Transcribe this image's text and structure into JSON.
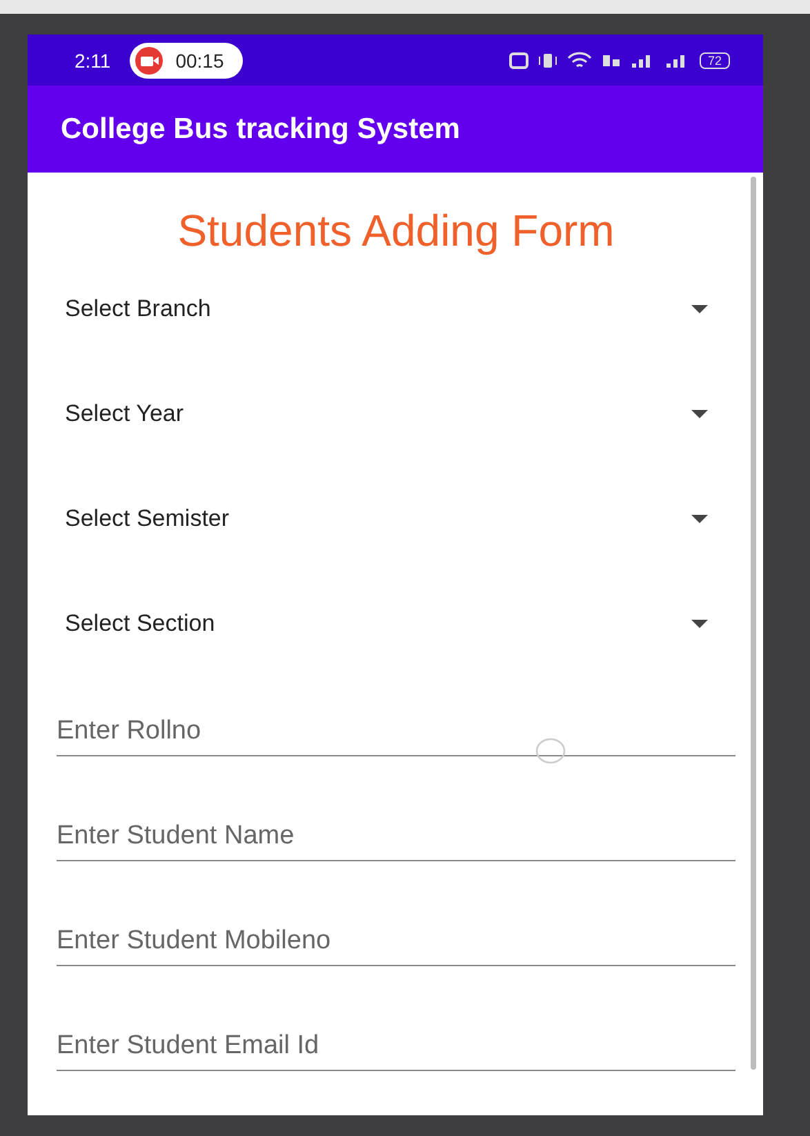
{
  "status_bar": {
    "time": "2:11",
    "recording_timer": "00:15",
    "battery_level": "72"
  },
  "app_bar": {
    "title": "College Bus tracking System"
  },
  "form": {
    "title": "Students Adding Form",
    "dropdowns": [
      {
        "label": "Select Branch"
      },
      {
        "label": "Select Year"
      },
      {
        "label": "Select Semister"
      },
      {
        "label": "Select Section"
      }
    ],
    "fields": [
      {
        "placeholder": "Enter Rollno"
      },
      {
        "placeholder": "Enter Student Name"
      },
      {
        "placeholder": "Enter Student Mobileno"
      },
      {
        "placeholder": "Enter Student Email Id"
      }
    ]
  }
}
